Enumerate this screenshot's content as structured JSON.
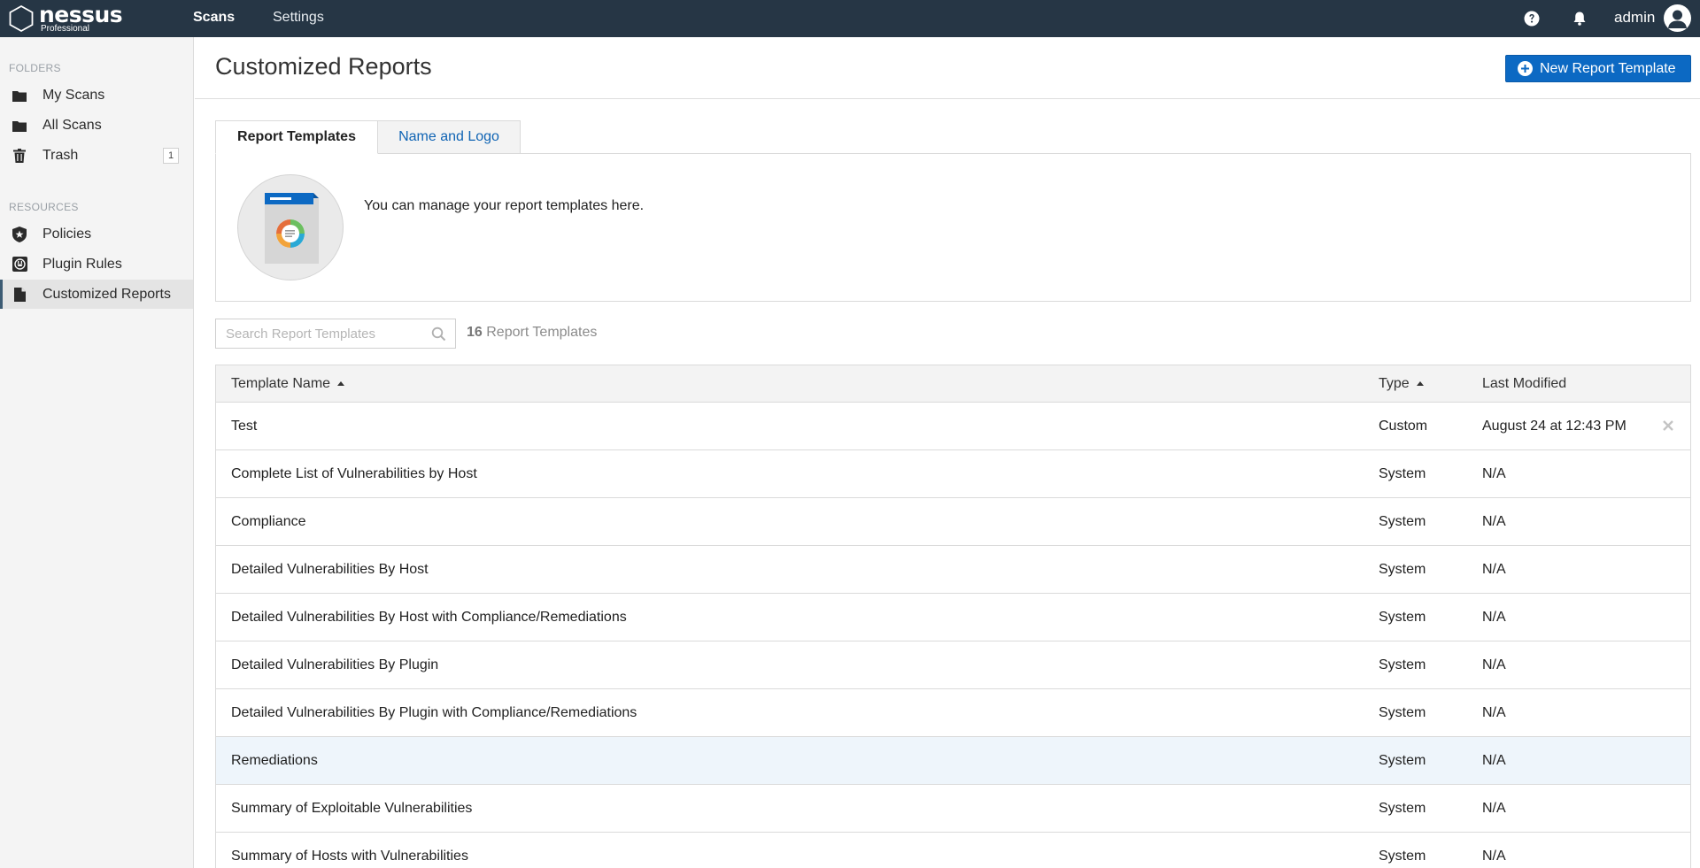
{
  "app": {
    "logo_word": "nessus",
    "logo_sub": "Professional",
    "nav": [
      {
        "label": "Scans"
      },
      {
        "label": "Settings"
      }
    ],
    "username": "admin"
  },
  "sidebar": {
    "folders_label": "FOLDERS",
    "resources_label": "RESOURCES",
    "folders": [
      {
        "label": "My Scans",
        "icon": "folder-icon"
      },
      {
        "label": "All Scans",
        "icon": "folder-icon"
      },
      {
        "label": "Trash",
        "icon": "trash-icon",
        "badge": "1"
      }
    ],
    "resources": [
      {
        "label": "Policies",
        "icon": "shield-star-icon"
      },
      {
        "label": "Plugin Rules",
        "icon": "plugin-icon"
      },
      {
        "label": "Customized Reports",
        "icon": "document-icon",
        "active": true
      }
    ]
  },
  "main": {
    "title": "Customized Reports",
    "new_button_label": "New Report Template",
    "tabs": [
      {
        "label": "Report Templates",
        "active": true
      },
      {
        "label": "Name and Logo",
        "active": false
      }
    ],
    "info_text": "You can manage your report templates here.",
    "search_placeholder": "Search Report Templates",
    "count_number": "16",
    "count_label": "Report Templates",
    "columns": {
      "name": "Template Name",
      "type": "Type",
      "modified": "Last Modified"
    },
    "rows": [
      {
        "name": "Test",
        "type": "Custom",
        "modified": "August 24 at 12:43 PM",
        "deletable": true
      },
      {
        "name": "Complete List of Vulnerabilities by Host",
        "type": "System",
        "modified": "N/A"
      },
      {
        "name": "Compliance",
        "type": "System",
        "modified": "N/A"
      },
      {
        "name": "Detailed Vulnerabilities By Host",
        "type": "System",
        "modified": "N/A"
      },
      {
        "name": "Detailed Vulnerabilities By Host with Compliance/Remediations",
        "type": "System",
        "modified": "N/A"
      },
      {
        "name": "Detailed Vulnerabilities By Plugin",
        "type": "System",
        "modified": "N/A"
      },
      {
        "name": "Detailed Vulnerabilities By Plugin with Compliance/Remediations",
        "type": "System",
        "modified": "N/A"
      },
      {
        "name": "Remediations",
        "type": "System",
        "modified": "N/A",
        "highlighted": true
      },
      {
        "name": "Summary of Exploitable Vulnerabilities",
        "type": "System",
        "modified": "N/A"
      },
      {
        "name": "Summary of Hosts with Vulnerabilities",
        "type": "System",
        "modified": "N/A"
      }
    ]
  },
  "colors": {
    "topbar": "#263645",
    "accent_button": "#0c69c3",
    "link": "#1064b4",
    "highlight_row": "#eef5fb"
  }
}
